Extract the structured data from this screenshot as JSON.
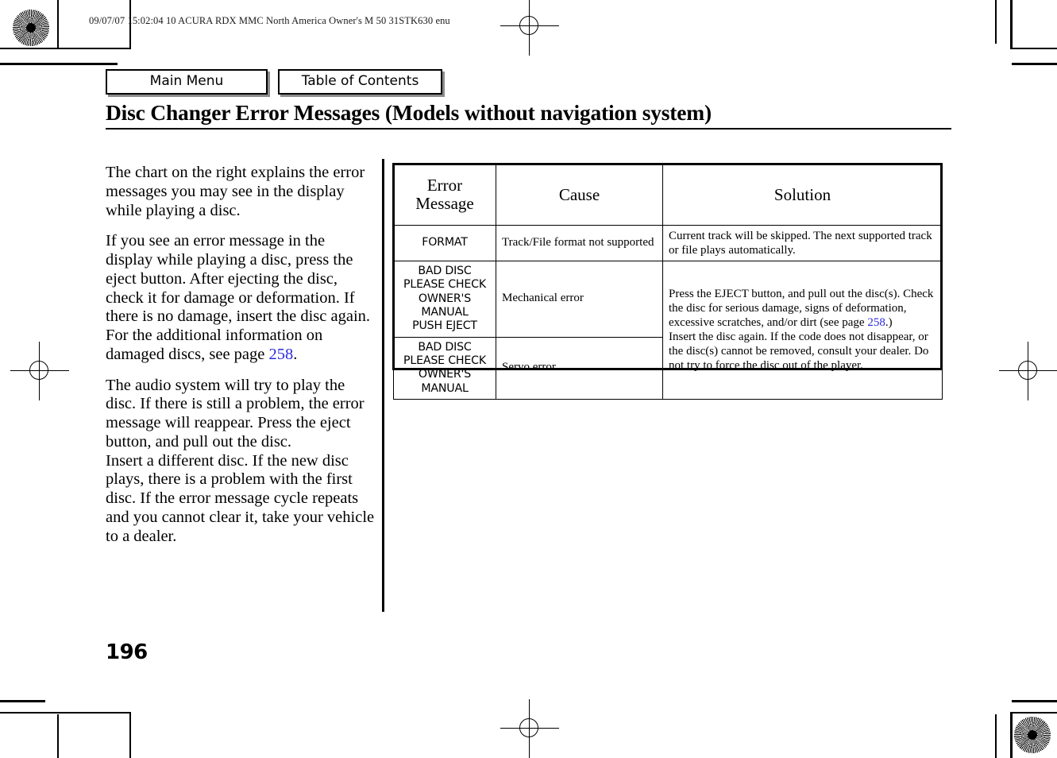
{
  "print_header": {
    "text": "09/07/07 15:02:04    10 ACURA RDX MMC North America Owner's M 50 31STK630 enu"
  },
  "nav": {
    "main_menu": "Main Menu",
    "table_of_contents": "Table of Contents"
  },
  "page": {
    "title": "Disc Changer Error Messages (Models without navigation system)",
    "number": "196"
  },
  "left_column": {
    "paragraph_1": "The chart on the right explains the error messages you may see in the display while playing a disc.",
    "paragraph_2_part1": "If you see an error message in the display while playing a disc, press the eject button. After ejecting the disc, check it for damage or deformation. If there is no damage, insert the disc again.",
    "paragraph_2_part2": "For the additional information on damaged discs, see page ",
    "paragraph_2_link": "258",
    "paragraph_2_end": ".",
    "paragraph_3_part1": "The audio system will try to play the disc. If there is still a problem, the error message will reappear. Press the eject button, and pull out the disc.",
    "paragraph_3_part2": "Insert a different disc. If the new disc plays, there is a problem with the first disc. If the error message cycle repeats and you cannot clear it, take your vehicle to a dealer."
  },
  "table": {
    "headers": {
      "error_message": "Error\nMessage",
      "error_message_line1": "Error",
      "error_message_line2": "Message",
      "cause": "Cause",
      "solution": "Solution"
    },
    "rows": [
      {
        "error_message": "FORMAT",
        "cause": "Track/File format not supported",
        "solution": "Current track will be skipped. The next supported track or file plays automatically."
      },
      {
        "error_message": "BAD DISC\nPLEASE CHECK\nOWNER'S\nMANUAL\nPUSH EJECT",
        "error_message_lines": [
          "BAD DISC",
          "PLEASE CHECK",
          "OWNER'S",
          "MANUAL",
          "PUSH EJECT"
        ],
        "cause": "Mechanical error"
      },
      {
        "error_message": "BAD DISC\nPLEASE CHECK\nOWNER'S\nMANUAL",
        "error_message_lines": [
          "BAD DISC",
          "PLEASE CHECK",
          "OWNER'S",
          "MANUAL"
        ],
        "cause": "Servo error"
      }
    ],
    "merged_solution": {
      "part1": "Press the EJECT button, and pull out the disc(s). Check the disc for serious damage, signs of deformation, excessive scratches, and/or dirt (see page ",
      "link": "258",
      "part2": ".)",
      "part3": "Insert the disc again. If the code does not disappear, or the disc(s) cannot be removed, consult your dealer. Do not try to force the disc out of the player."
    }
  },
  "colors": {
    "link": "#2a2ae0",
    "text": "#000000",
    "button_shadow": "#8c8c8c"
  }
}
